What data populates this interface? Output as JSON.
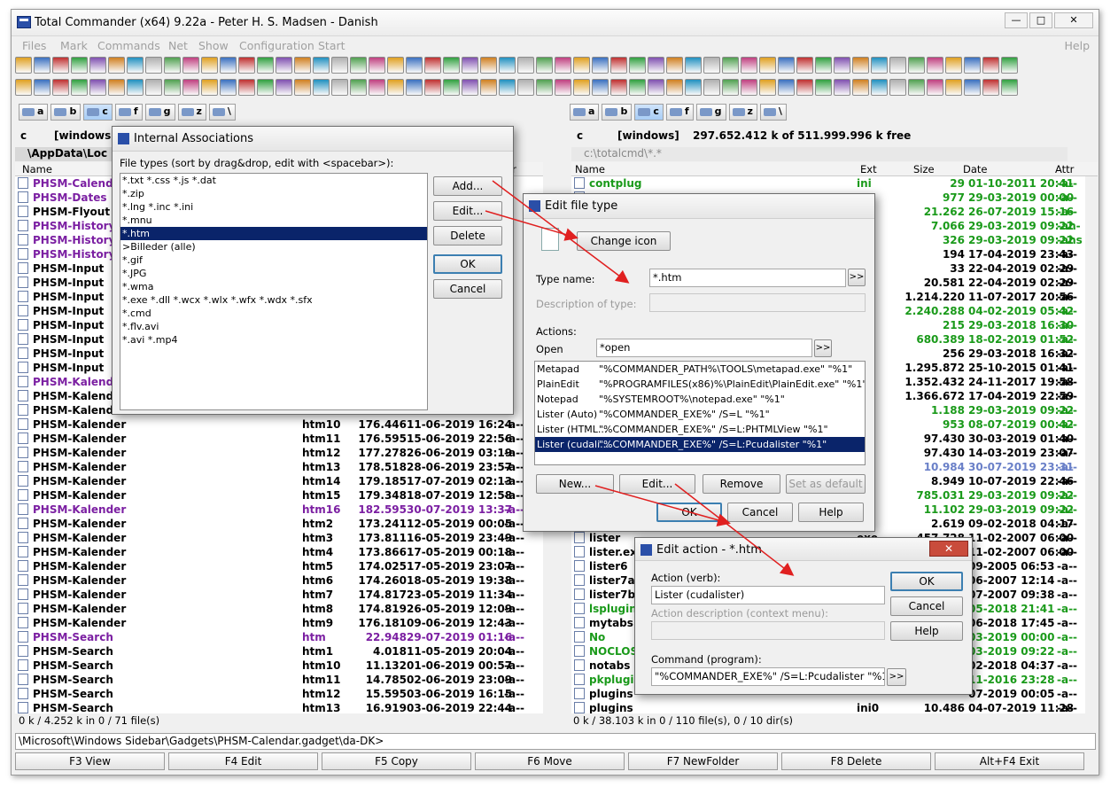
{
  "window": {
    "title": "Total Commander (x64) 9.22a - Peter H. S. Madsen - Danish",
    "minimize": "—",
    "maximize": "□",
    "close": "✕"
  },
  "menu": {
    "items": [
      "Files",
      "Mark",
      "Commands",
      "Net",
      "Show",
      "Configuration",
      "Start"
    ],
    "help": "Help"
  },
  "toolbar_colors": [
    "#e0a020",
    "#3a70c0",
    "#c03030",
    "#30a040",
    "#8050b0",
    "#d08020",
    "#2090c0",
    "#b0b0b0",
    "#50a050",
    "#c04080"
  ],
  "drives_left": [
    "a",
    "b",
    "c",
    "f",
    "g",
    "z",
    "\\"
  ],
  "drives_right": [
    "a",
    "b",
    "c",
    "f",
    "g",
    "z",
    "\\"
  ],
  "left": {
    "drive_select": "c",
    "path_label": "[windows",
    "path": "\\AppData\\Loc",
    "col_name": "Name",
    "col_attr": "ttr",
    "files": [
      {
        "name": "PHSM-Calenda",
        "color": "#7b1fa2"
      },
      {
        "name": "PHSM-Dates",
        "color": "#7b1fa2"
      },
      {
        "name": "PHSM-Flyout",
        "color": "#000"
      },
      {
        "name": "PHSM-History",
        "color": "#7b1fa2"
      },
      {
        "name": "PHSM-History",
        "color": "#7b1fa2"
      },
      {
        "name": "PHSM-History",
        "color": "#7b1fa2"
      },
      {
        "name": "PHSM-Input",
        "color": "#000"
      },
      {
        "name": "PHSM-Input",
        "color": "#000"
      },
      {
        "name": "PHSM-Input",
        "color": "#000"
      },
      {
        "name": "PHSM-Input",
        "color": "#000"
      },
      {
        "name": "PHSM-Input",
        "color": "#000"
      },
      {
        "name": "PHSM-Input",
        "color": "#000"
      },
      {
        "name": "PHSM-Input",
        "color": "#000"
      },
      {
        "name": "PHSM-Input",
        "color": "#000"
      },
      {
        "name": "PHSM-Kalender",
        "color": "#7b1fa2"
      },
      {
        "name": "PHSM-Kalender",
        "color": "#000"
      },
      {
        "name": "PHSM-Kalender",
        "color": "#000"
      },
      {
        "name": "PHSM-Kalender",
        "ext": "htm10",
        "size": "176.446",
        "date": "11-06-2019 16:24",
        "attr": "-a--",
        "color": "#000"
      },
      {
        "name": "PHSM-Kalender",
        "ext": "htm11",
        "size": "176.595",
        "date": "15-06-2019 22:56",
        "attr": "-a--",
        "color": "#000"
      },
      {
        "name": "PHSM-Kalender",
        "ext": "htm12",
        "size": "177.278",
        "date": "26-06-2019 03:19",
        "attr": "-a--",
        "color": "#000"
      },
      {
        "name": "PHSM-Kalender",
        "ext": "htm13",
        "size": "178.518",
        "date": "28-06-2019 23:57",
        "attr": "-a--",
        "color": "#000"
      },
      {
        "name": "PHSM-Kalender",
        "ext": "htm14",
        "size": "179.185",
        "date": "17-07-2019 02:13",
        "attr": "-a--",
        "color": "#000"
      },
      {
        "name": "PHSM-Kalender",
        "ext": "htm15",
        "size": "179.348",
        "date": "18-07-2019 12:58",
        "attr": "-a--",
        "color": "#000"
      },
      {
        "name": "PHSM-Kalender",
        "ext": "htm16",
        "size": "182.595",
        "date": "30-07-2019 13:37",
        "attr": "-a--",
        "color": "#7b1fa2"
      },
      {
        "name": "PHSM-Kalender",
        "ext": "htm2",
        "size": "173.241",
        "date": "12-05-2019 00:05",
        "attr": "-a--",
        "color": "#000"
      },
      {
        "name": "PHSM-Kalender",
        "ext": "htm3",
        "size": "173.811",
        "date": "16-05-2019 23:49",
        "attr": "-a--",
        "color": "#000"
      },
      {
        "name": "PHSM-Kalender",
        "ext": "htm4",
        "size": "173.866",
        "date": "17-05-2019 00:18",
        "attr": "-a--",
        "color": "#000"
      },
      {
        "name": "PHSM-Kalender",
        "ext": "htm5",
        "size": "174.025",
        "date": "17-05-2019 23:07",
        "attr": "-a--",
        "color": "#000"
      },
      {
        "name": "PHSM-Kalender",
        "ext": "htm6",
        "size": "174.260",
        "date": "18-05-2019 19:38",
        "attr": "-a--",
        "color": "#000"
      },
      {
        "name": "PHSM-Kalender",
        "ext": "htm7",
        "size": "174.817",
        "date": "23-05-2019 11:34",
        "attr": "-a--",
        "color": "#000"
      },
      {
        "name": "PHSM-Kalender",
        "ext": "htm8",
        "size": "174.819",
        "date": "26-05-2019 12:09",
        "attr": "-a--",
        "color": "#000"
      },
      {
        "name": "PHSM-Kalender",
        "ext": "htm9",
        "size": "176.181",
        "date": "09-06-2019 12:43",
        "attr": "-a--",
        "color": "#000"
      },
      {
        "name": "PHSM-Search",
        "ext": "htm",
        "size": "22.948",
        "date": "29-07-2019 01:16",
        "attr": "-a--",
        "color": "#7b1fa2"
      },
      {
        "name": "PHSM-Search",
        "ext": "htm1",
        "size": "4.018",
        "date": "11-05-2019 20:04",
        "attr": "-a--",
        "color": "#000"
      },
      {
        "name": "PHSM-Search",
        "ext": "htm10",
        "size": "11.132",
        "date": "01-06-2019 00:57",
        "attr": "-a--",
        "color": "#000"
      },
      {
        "name": "PHSM-Search",
        "ext": "htm11",
        "size": "14.785",
        "date": "02-06-2019 23:09",
        "attr": "-a--",
        "color": "#000"
      },
      {
        "name": "PHSM-Search",
        "ext": "htm12",
        "size": "15.595",
        "date": "03-06-2019 16:15",
        "attr": "-a--",
        "color": "#000"
      },
      {
        "name": "PHSM-Search",
        "ext": "htm13",
        "size": "16.919",
        "date": "03-06-2019 22:44",
        "attr": "-a--",
        "color": "#000"
      }
    ],
    "status": "0 k / 4.252 k in 0 / 71 file(s)"
  },
  "right": {
    "drive_select": "c",
    "path_label": "[windows]",
    "free": "297.652.412 k of 511.999.996 k free",
    "path": "c:\\totalcmd\\*.*",
    "col_name": "Name",
    "col_ext": "Ext",
    "col_size": "Size",
    "col_date": "Date",
    "col_attr": "Attr",
    "files": [
      {
        "name": "contplug",
        "ext": "ini",
        "size": "29",
        "date": "01-10-2011 20:41",
        "attr": "-a--",
        "color": "#1a9a1a"
      },
      {
        "name": "",
        "ext": "",
        "size": "977",
        "date": "29-03-2019 00:00",
        "attr": "-a--",
        "color": "#1a9a1a"
      },
      {
        "name": "",
        "ext": "",
        "size": "21.262",
        "date": "26-07-2019 15:16",
        "attr": "-a--",
        "color": "#1a9a1a"
      },
      {
        "name": "",
        "ext": "",
        "size": "7.066",
        "date": "29-03-2019 09:22",
        "attr": "-ah-",
        "color": "#1a9a1a"
      },
      {
        "name": "",
        "ext": "",
        "size": "326",
        "date": "29-03-2019 09:22",
        "attr": "-ahs",
        "color": "#1a9a1a"
      },
      {
        "name": "",
        "ext": "",
        "size": "194",
        "date": "17-04-2019 23:43",
        "attr": "-a--",
        "color": "#000"
      },
      {
        "name": "",
        "ext": "",
        "size": "33",
        "date": "22-04-2019 02:29",
        "attr": "-a--",
        "color": "#000"
      },
      {
        "name": "",
        "ext": "",
        "size": "20.581",
        "date": "22-04-2019 02:29",
        "attr": "-a--",
        "color": "#000"
      },
      {
        "name": "",
        "ext": "",
        "size": "1.214.220",
        "date": "11-07-2017 20:56",
        "attr": "-a--",
        "color": "#000"
      },
      {
        "name": "",
        "ext": "",
        "size": "2.240.288",
        "date": "04-02-2019 05:42",
        "attr": "-a--",
        "color": "#1a9a1a"
      },
      {
        "name": "",
        "ext": "",
        "size": "215",
        "date": "29-03-2018 16:30",
        "attr": "-a--",
        "color": "#1a9a1a"
      },
      {
        "name": "",
        "ext": "",
        "size": "680.389",
        "date": "18-02-2019 01:52",
        "attr": "-a--",
        "color": "#1a9a1a"
      },
      {
        "name": "",
        "ext": "",
        "size": "256",
        "date": "29-03-2018 16:32",
        "attr": "-a--",
        "color": "#000"
      },
      {
        "name": "",
        "ext": "",
        "size": "1.295.872",
        "date": "25-10-2015 01:41",
        "attr": "-a--",
        "color": "#000"
      },
      {
        "name": "",
        "ext": "",
        "size": "1.352.432",
        "date": "24-11-2017 19:58",
        "attr": "-a--",
        "color": "#000"
      },
      {
        "name": "",
        "ext": "",
        "size": "1.366.672",
        "date": "17-04-2019 22:59",
        "attr": "-a--",
        "color": "#000"
      },
      {
        "name": "",
        "ext": "",
        "size": "1.188",
        "date": "29-03-2019 09:22",
        "attr": "-a--",
        "color": "#1a9a1a"
      },
      {
        "name": "",
        "ext": "",
        "size": "953",
        "date": "08-07-2019 00:42",
        "attr": "-a--",
        "color": "#1a9a1a"
      },
      {
        "name": "",
        "ext": "",
        "size": "97.430",
        "date": "30-03-2019 01:40",
        "attr": "-a--",
        "color": "#000"
      },
      {
        "name": "",
        "ext": "",
        "size": "97.430",
        "date": "14-03-2019 23:07",
        "attr": "-a--",
        "color": "#000"
      },
      {
        "name": "",
        "ext": "",
        "size": "10.984",
        "date": "30-07-2019 23:31",
        "attr": "-a--",
        "color": "#6a80c8"
      },
      {
        "name": "",
        "ext": "",
        "size": "8.949",
        "date": "10-07-2019 22:46",
        "attr": "-a--",
        "color": "#000"
      },
      {
        "name": "",
        "ext": "",
        "size": "785.031",
        "date": "29-03-2019 09:22",
        "attr": "-a--",
        "color": "#1a9a1a"
      },
      {
        "name": "",
        "ext": "",
        "size": "11.102",
        "date": "29-03-2019 09:22",
        "attr": "-a--",
        "color": "#1a9a1a"
      },
      {
        "name": "",
        "ext": "",
        "size": "2.619",
        "date": "09-02-2018 04:17",
        "attr": "-a--",
        "color": "#000"
      },
      {
        "name": "lister",
        "ext": "exe",
        "size": "457.728",
        "date": "11-02-2007 06:00",
        "attr": "-a--",
        "color": "#000"
      },
      {
        "name": "lister.exe",
        "ext": "",
        "size": "",
        "date": "11-02-2007 06:00",
        "attr": "-a--",
        "color": "#000"
      },
      {
        "name": "lister6",
        "ext": "",
        "size": "",
        "date": "09-2005 06:53",
        "attr": "-a--",
        "color": "#000"
      },
      {
        "name": "lister7a",
        "ext": "",
        "size": "",
        "date": "06-2007 12:14",
        "attr": "-a--",
        "color": "#000"
      },
      {
        "name": "lister7b",
        "ext": "",
        "size": "",
        "date": "07-2007 09:38",
        "attr": "-a--",
        "color": "#000"
      },
      {
        "name": "lsplugin",
        "ext": "",
        "size": "",
        "date": "05-2018 21:41",
        "attr": "-a--",
        "color": "#1a9a1a"
      },
      {
        "name": "mytabs",
        "ext": "",
        "size": "",
        "date": "06-2018 17:45",
        "attr": "-a--",
        "color": "#000"
      },
      {
        "name": "No",
        "ext": "",
        "size": "",
        "date": "03-2019 00:00",
        "attr": "-a--",
        "color": "#1a9a1a"
      },
      {
        "name": "NOCLOSE",
        "ext": "",
        "size": "",
        "date": "03-2019 09:22",
        "attr": "-a--",
        "color": "#1a9a1a"
      },
      {
        "name": "notabs",
        "ext": "",
        "size": "",
        "date": "02-2018 04:37",
        "attr": "-a--",
        "color": "#000"
      },
      {
        "name": "pkplugin",
        "ext": "",
        "size": "",
        "date": "11-2016 23:28",
        "attr": "-a--",
        "color": "#1a9a1a"
      },
      {
        "name": "plugins",
        "ext": "",
        "size": "",
        "date": "07-2019 00:05",
        "attr": "-a--",
        "color": "#000"
      },
      {
        "name": "plugins",
        "ext": "ini0",
        "size": "10.486",
        "date": "04-07-2019 11:28",
        "attr": "-a--",
        "color": "#000"
      }
    ],
    "status": "0 k / 38.103 k in 0 / 110 file(s), 0 / 10 dir(s)"
  },
  "cmdline": "\\Microsoft\\Windows Sidebar\\Gadgets\\PHSM-Calendar.gadget\\da-DK>",
  "fkeys": [
    "F3 View",
    "F4 Edit",
    "F5 Copy",
    "F6 Move",
    "F7 NewFolder",
    "F8 Delete",
    "Alt+F4 Exit"
  ],
  "assoc": {
    "title": "Internal Associations",
    "label": "File types (sort by drag&drop, edit with <spacebar>):",
    "types": [
      "*.txt *.css *.js *.dat",
      "*.zip",
      "*.lng *.inc *.ini",
      "*.mnu",
      "*.htm",
      ">Billeder (alle)",
      "*.gif",
      "*.JPG",
      "*.wma",
      "*.exe *.dll *.wcx *.wlx *.wfx *.wdx *.sfx",
      "*.cmd",
      "*.flv.avi",
      "*.avi *.mp4"
    ],
    "selected": 4,
    "btn_add": "Add...",
    "btn_edit": "Edit...",
    "btn_delete": "Delete",
    "btn_ok": "OK",
    "btn_cancel": "Cancel"
  },
  "edit_type": {
    "title": "Edit file type",
    "change_icon": "Change icon",
    "type_name_label": "Type name:",
    "type_name": "*.htm",
    "desc_label": "Description of type:",
    "desc": "",
    "actions_label": "Actions:",
    "open_label": "Open",
    "open_value": "*open",
    "actions": [
      {
        "name": "Metapad",
        "cmd": "\"%COMMANDER_PATH%\\TOOLS\\metapad.exe\" \"%1\""
      },
      {
        "name": "PlainEdit",
        "cmd": "\"%PROGRAMFILES(x86)%\\PlainEdit\\PlainEdit.exe\" \"%1\""
      },
      {
        "name": "Notepad",
        "cmd": "\"%SYSTEMROOT%\\notepad.exe\" \"%1\""
      },
      {
        "name": "Lister (Auto)",
        "cmd": "\"%COMMANDER_EXE%\" /S=L \"%1\""
      },
      {
        "name": "Lister (HTML...",
        "cmd": "\"%COMMANDER_EXE%\" /S=L:PHTMLView \"%1\""
      },
      {
        "name": "Lister (cudali...",
        "cmd": "\"%COMMANDER_EXE%\" /S=L:Pcudalister \"%1\""
      }
    ],
    "selected": 5,
    "btn_new": "New...",
    "btn_edit": "Edit...",
    "btn_remove": "Remove",
    "btn_default": "Set as default",
    "btn_ok": "OK",
    "btn_cancel": "Cancel",
    "btn_help": "Help",
    "more": ">>"
  },
  "edit_action": {
    "title": "Edit action - *.htm",
    "verb_label": "Action (verb):",
    "verb": "Lister (cudalister)",
    "desc_label": "Action description (context menu):",
    "desc": "",
    "cmd_label": "Command (program):",
    "cmd": "\"%COMMANDER_EXE%\" /S=L:Pcudalister \"%1\"",
    "btn_ok": "OK",
    "btn_cancel": "Cancel",
    "btn_help": "Help",
    "more": ">>"
  },
  "arrow_color": "#e02020"
}
